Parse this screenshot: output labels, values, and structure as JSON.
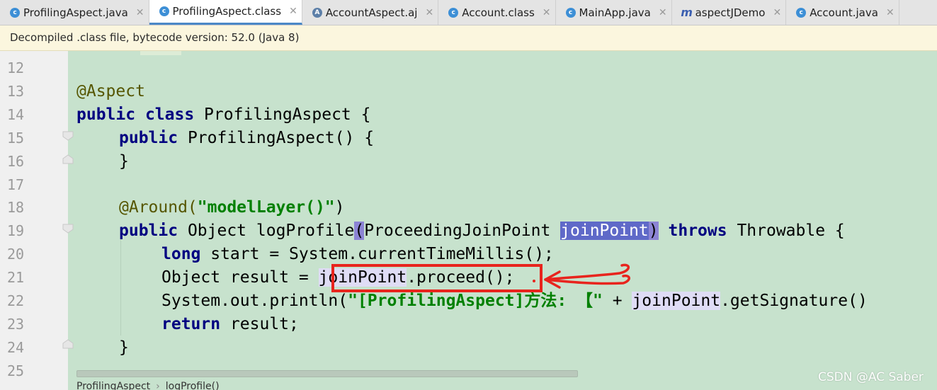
{
  "tabs": [
    {
      "label": "ProfilingAspect.java",
      "icon": "class-icon",
      "active": false
    },
    {
      "label": "ProfilingAspect.class",
      "icon": "class-icon",
      "active": true
    },
    {
      "label": "AccountAspect.aj",
      "icon": "aspect-icon",
      "active": false
    },
    {
      "label": "Account.class",
      "icon": "class-icon",
      "active": false
    },
    {
      "label": "MainApp.java",
      "icon": "class-icon",
      "active": false
    },
    {
      "label": "aspectJDemo",
      "icon": "maven-icon",
      "active": false
    },
    {
      "label": "Account.java",
      "icon": "class-icon",
      "active": false
    }
  ],
  "notice": "Decompiled .class file, bytecode version: 52.0 (Java 8)",
  "lines": {
    "n12": "12",
    "n13": "13",
    "n14": "14",
    "n15": "15",
    "n16": "16",
    "n17": "17",
    "n18": "18",
    "n19": "19",
    "n20": "20",
    "n21": "21",
    "n22": "22",
    "n23": "23",
    "n24": "24",
    "n25": "25"
  },
  "code": {
    "l13_ann": "@Aspect",
    "l14_kw1": "public",
    "l14_kw2": "class",
    "l14_rest": " ProfilingAspect {",
    "l15_kw": "public",
    "l15_rest": " ProfilingAspect() {",
    "l16": "}",
    "l18_ann": "@Around(",
    "l18_str": "\"modelLayer()\"",
    "l18_end": ")",
    "l19_kw": "public",
    "l19_mid": " Object logProfile",
    "l19_lp": "(",
    "l19_type": "ProceedingJoinPoint ",
    "l19_param": "joinPoint",
    "l19_rp": ")",
    "l19_kw2": "throws",
    "l19_rest": " Throwable {",
    "l20_kw": "long",
    "l20_rest": " start = System.currentTimeMillis();",
    "l21_pre": "Object result = ",
    "l21_id": "joinPoint",
    "l21_rest": ".proceed();",
    "l22_pre": "System.out.println(",
    "l22_str": "\"[ProfilingAspect]方法: 【\"",
    "l22_plus": " + ",
    "l22_id": "joinPoint",
    "l22_rest": ".getSignature()",
    "l23_kw": "return",
    "l23_rest": " result;",
    "l24": "}"
  },
  "breadcrumb": {
    "class": "ProfilingAspect",
    "method": "logProfile()"
  },
  "watermark": "CSDN @AC Saber",
  "colors": {
    "annotation_red": "#e8241d",
    "code_bg": "#c7e2cd",
    "keyword": "#000080",
    "string": "#008000"
  }
}
